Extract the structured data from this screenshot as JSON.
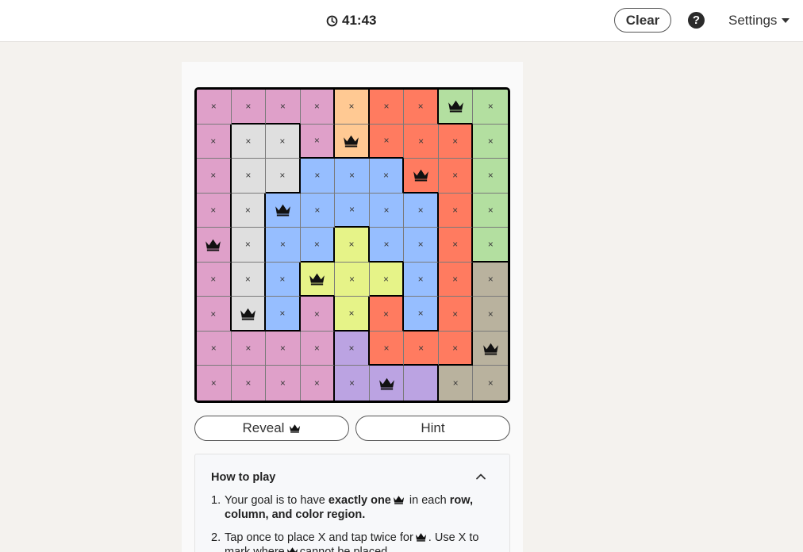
{
  "header": {
    "timer": "41:43",
    "clear_label": "Clear",
    "help_glyph": "?",
    "settings_label": "Settings"
  },
  "board": {
    "size": 9,
    "colors": {
      "pink": "#dfa0c9",
      "gray": "#dfdfdf",
      "orange": "#ffc993",
      "red": "#ff7b60",
      "green": "#b3dfa0",
      "blue": "#96beff",
      "yellow": "#e6f388",
      "tan": "#b9b29e",
      "purple": "#bba3e2"
    },
    "regions": [
      [
        "pink",
        "pink",
        "pink",
        "pink",
        "orange",
        "red",
        "red",
        "green",
        "green"
      ],
      [
        "pink",
        "gray",
        "gray",
        "pink",
        "orange",
        "red",
        "red",
        "red",
        "green"
      ],
      [
        "pink",
        "gray",
        "gray",
        "blue",
        "blue",
        "blue",
        "red",
        "red",
        "green"
      ],
      [
        "pink",
        "gray",
        "blue",
        "blue",
        "blue",
        "blue",
        "blue",
        "red",
        "green"
      ],
      [
        "pink",
        "gray",
        "blue",
        "blue",
        "yellow",
        "blue",
        "blue",
        "red",
        "green"
      ],
      [
        "pink",
        "gray",
        "blue",
        "yellow",
        "yellow",
        "yellow",
        "blue",
        "red",
        "tan"
      ],
      [
        "pink",
        "gray",
        "blue",
        "pink",
        "yellow",
        "red",
        "blue",
        "red",
        "tan"
      ],
      [
        "pink",
        "pink",
        "pink",
        "pink",
        "purple",
        "red",
        "red",
        "red",
        "tan"
      ],
      [
        "pink",
        "pink",
        "pink",
        "pink",
        "purple",
        "purple",
        "purple",
        "tan",
        "tan"
      ]
    ],
    "marks": [
      [
        "x",
        "x",
        "x",
        "x",
        "x",
        "x",
        "x",
        "Q",
        "x"
      ],
      [
        "x",
        "x",
        "x",
        "x",
        "Q",
        "x",
        "x",
        "x",
        "x"
      ],
      [
        "x",
        "x",
        "x",
        "x",
        "x",
        "x",
        "Q",
        "x",
        "x"
      ],
      [
        "x",
        "x",
        "Q",
        "x",
        "x",
        "x",
        "x",
        "x",
        "x"
      ],
      [
        "Q",
        "x",
        "x",
        "x",
        "x",
        "x",
        "x",
        "x",
        "x"
      ],
      [
        "x",
        "x",
        "x",
        "Q",
        "x",
        "x",
        "x",
        "x",
        "x"
      ],
      [
        "x",
        "Q",
        "x",
        "x",
        "x",
        "x",
        "x",
        "x",
        "x"
      ],
      [
        "x",
        "x",
        "x",
        "x",
        "x",
        "x",
        "x",
        "x",
        "Q"
      ],
      [
        "x",
        "x",
        "x",
        "x",
        "x",
        "Q",
        "",
        "x",
        "x"
      ]
    ],
    "x_glyph": "×"
  },
  "actions": {
    "reveal_label": "Reveal",
    "hint_label": "Hint"
  },
  "how_to_play": {
    "title": "How to play",
    "step1": {
      "num": "1.",
      "a": "Your goal is to have ",
      "b": "exactly one",
      "c": " in each ",
      "d": "row, column, and color region."
    },
    "step2": {
      "num": "2.",
      "a": "Tap once to place X and tap twice for",
      "b": ". Use X to mark where",
      "c": "cannot be placed."
    }
  }
}
